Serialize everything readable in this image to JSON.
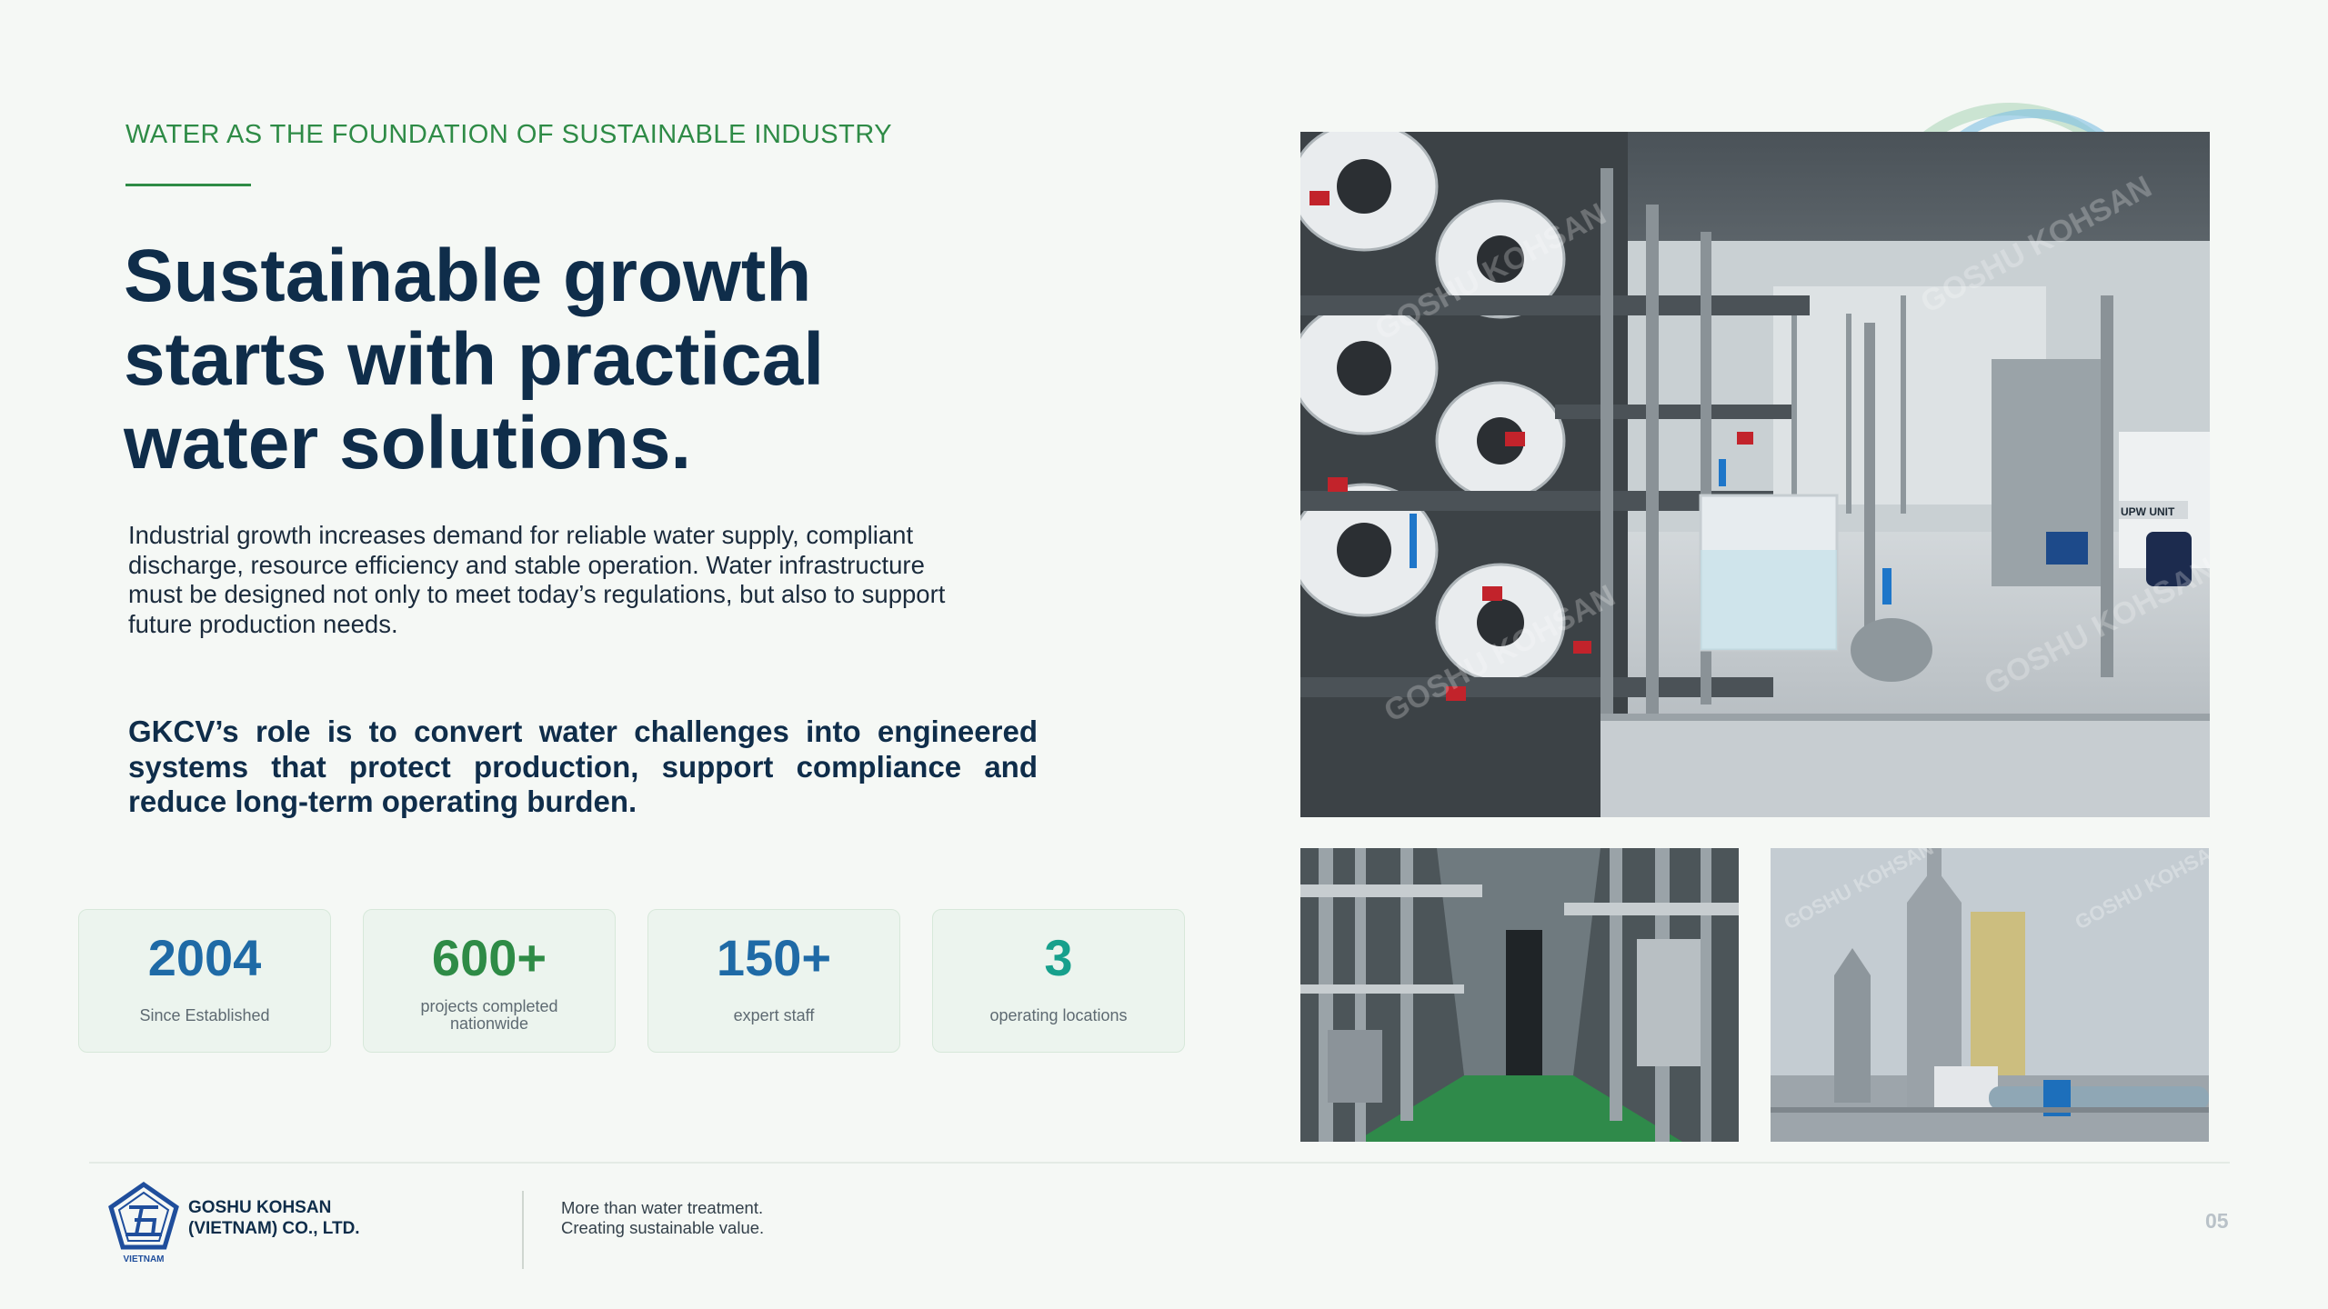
{
  "eyebrow": "WATER AS THE FOUNDATION OF SUSTAINABLE INDUSTRY",
  "headline": [
    "Sustainable growth",
    "starts with practical",
    "water solutions."
  ],
  "body_lines": [
    "Industrial growth increases demand for reliable water supply, compliant",
    "discharge, resource efficiency and stable operation. Water infrastructure",
    "must be designed not only to meet today’s regulations, but also to support",
    "future production needs."
  ],
  "role_lines": [
    "GKCV’s role is to convert water challenges into engineered",
    "systems that protect production, support compliance and",
    "reduce long-term operating burden."
  ],
  "stats": [
    {
      "value": "2004",
      "label": "Since Established",
      "color": "#1f6aa6"
    },
    {
      "value": "600+",
      "label": "projects completed nationwide",
      "color": "#2e8b46"
    },
    {
      "value": "150+",
      "label": "expert staff",
      "color": "#1f6aa6"
    },
    {
      "value": "3",
      "label": "operating locations",
      "color": "#17a08c"
    }
  ],
  "photos": [
    {
      "name": "water-treatment-plant-room",
      "watermark": "GOSHU KOHSAN",
      "sign": "UPW UNIT"
    },
    {
      "name": "piping-corridor"
    },
    {
      "name": "scrubber-towers",
      "watermark": "GOSHU KOHSAN"
    }
  ],
  "footer": {
    "logo_caption": "VIETNAM",
    "company": [
      "GOSHU KOHSAN",
      "(VIETNAM) CO., LTD."
    ],
    "tagline": [
      "More than water treatment.",
      "Creating sustainable value."
    ],
    "page": "05"
  },
  "colors": {
    "accent_green": "#2e8b46",
    "navy": "#0f2d4a",
    "blue": "#1f6aa6",
    "teal": "#17a08c"
  }
}
